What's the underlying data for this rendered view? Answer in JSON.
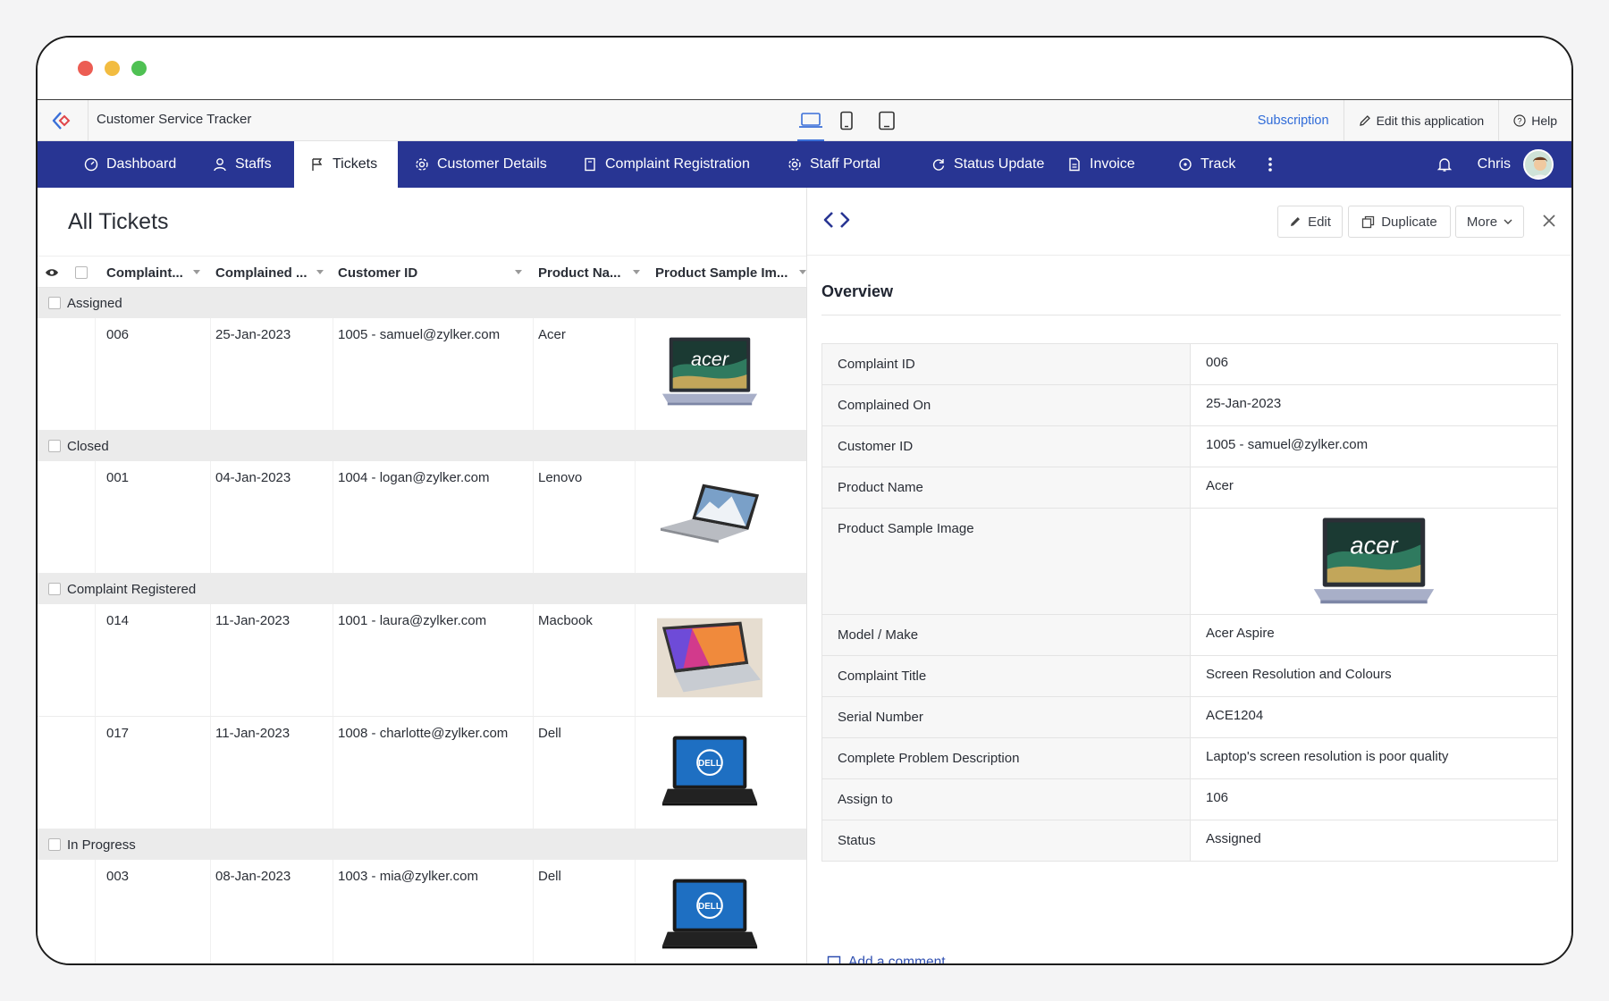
{
  "app": {
    "title": "Customer Service Tracker"
  },
  "appbar": {
    "subscription": "Subscription",
    "edit_app": "Edit this application",
    "help": "Help"
  },
  "nav": {
    "items": [
      {
        "label": "Dashboard",
        "icon": "dashboard-icon"
      },
      {
        "label": "Staffs",
        "icon": "user-icon"
      },
      {
        "label": "Tickets",
        "icon": "flag-icon"
      },
      {
        "label": "Customer Details",
        "icon": "gear-icon"
      },
      {
        "label": "Complaint Registration",
        "icon": "form-icon"
      },
      {
        "label": "Staff Portal",
        "icon": "gear-icon"
      },
      {
        "label": "Status Update",
        "icon": "refresh-icon"
      },
      {
        "label": "Invoice",
        "icon": "document-icon"
      },
      {
        "label": "Track",
        "icon": "target-icon"
      }
    ],
    "user": "Chris"
  },
  "list": {
    "title": "All Tickets",
    "columns": [
      "Complaint...",
      "Complained ...",
      "Customer ID",
      "Product Na...",
      "Product Sample Im..."
    ],
    "groups": [
      {
        "name": "Assigned",
        "rows": [
          {
            "id": "006",
            "date": "25-Jan-2023",
            "customer": "1005 - samuel@zylker.com",
            "product": "Acer",
            "image": "acer"
          }
        ]
      },
      {
        "name": "Closed",
        "rows": [
          {
            "id": "001",
            "date": "04-Jan-2023",
            "customer": "1004 - logan@zylker.com",
            "product": "Lenovo",
            "image": "lenovo"
          }
        ]
      },
      {
        "name": "Complaint Registered",
        "rows": [
          {
            "id": "014",
            "date": "11-Jan-2023",
            "customer": "1001 - laura@zylker.com",
            "product": "Macbook",
            "image": "macbook"
          },
          {
            "id": "017",
            "date": "11-Jan-2023",
            "customer": "1008 - charlotte@zylker.com",
            "product": "Dell",
            "image": "dell"
          }
        ]
      },
      {
        "name": "In Progress",
        "rows": [
          {
            "id": "003",
            "date": "08-Jan-2023",
            "customer": "1003 - mia@zylker.com",
            "product": "Dell",
            "image": "dell"
          }
        ]
      }
    ]
  },
  "detail": {
    "buttons": {
      "edit": "Edit",
      "duplicate": "Duplicate",
      "more": "More"
    },
    "overview": "Overview",
    "fields": [
      {
        "label": "Complaint ID",
        "value": "006"
      },
      {
        "label": "Complained On",
        "value": "25-Jan-2023"
      },
      {
        "label": "Customer ID",
        "value": "1005 - samuel@zylker.com"
      },
      {
        "label": "Product Name",
        "value": "Acer"
      },
      {
        "label": "Product Sample Image",
        "value": "",
        "image": "acer"
      },
      {
        "label": "Model / Make",
        "value": "Acer Aspire"
      },
      {
        "label": "Complaint Title",
        "value": "Screen Resolution and Colours"
      },
      {
        "label": "Serial Number",
        "value": "ACE1204"
      },
      {
        "label": "Complete Problem Description",
        "value": "Laptop's screen resolution is poor quality"
      },
      {
        "label": "Assign to",
        "value": "106"
      },
      {
        "label": "Status",
        "value": "Assigned"
      }
    ],
    "add_comment": "Add a comment"
  },
  "colors": {
    "nav_bg": "#283593",
    "link": "#2f6bd8",
    "accent": "#3a6fd8"
  }
}
